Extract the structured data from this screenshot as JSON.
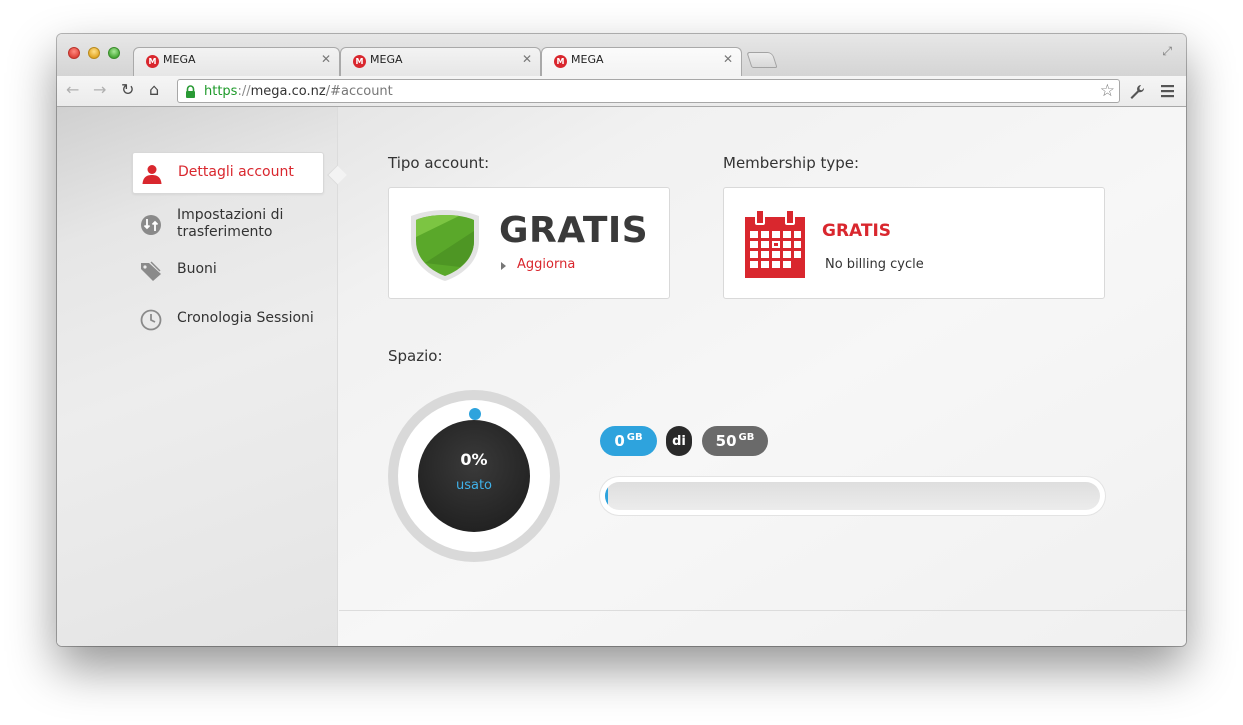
{
  "browser": {
    "tabs": [
      {
        "title": "MEGA",
        "favicon": "mega-logo"
      },
      {
        "title": "MEGA",
        "favicon": "mega-logo"
      },
      {
        "title": "MEGA",
        "favicon": "mega-logo"
      }
    ],
    "favicon_letter": "M",
    "url_scheme": "https",
    "url_sep": "://",
    "url_host": "mega.co.nz",
    "url_path": "/#account"
  },
  "sidebar": {
    "items": [
      {
        "label": "Dettagli account",
        "icon": "user-icon",
        "active": true
      },
      {
        "label": "Impostazioni di trasferimento",
        "icon": "transfer-icon",
        "active": false
      },
      {
        "label": "Buoni",
        "icon": "voucher-tag-icon",
        "active": false
      },
      {
        "label": "Cronologia Sessioni",
        "icon": "clock-icon",
        "active": false
      }
    ]
  },
  "account": {
    "type_label": "Tipo account:",
    "type_value": "GRATIS",
    "upgrade_label": "Aggiorna",
    "membership_label": "Membership type:",
    "membership_value": "GRATIS",
    "billing_text": "No billing cycle"
  },
  "storage": {
    "label": "Spazio:",
    "percent_text": "0%",
    "used_word": "usato",
    "used_num": "0",
    "used_unit": "GB",
    "of_word": "di",
    "total_num": "50",
    "total_unit": "GB",
    "used_fraction": 0.0
  },
  "colors": {
    "brand_red": "#d9272e",
    "storage_blue": "#2ea3dd",
    "shield_green": "#5aa82a"
  }
}
